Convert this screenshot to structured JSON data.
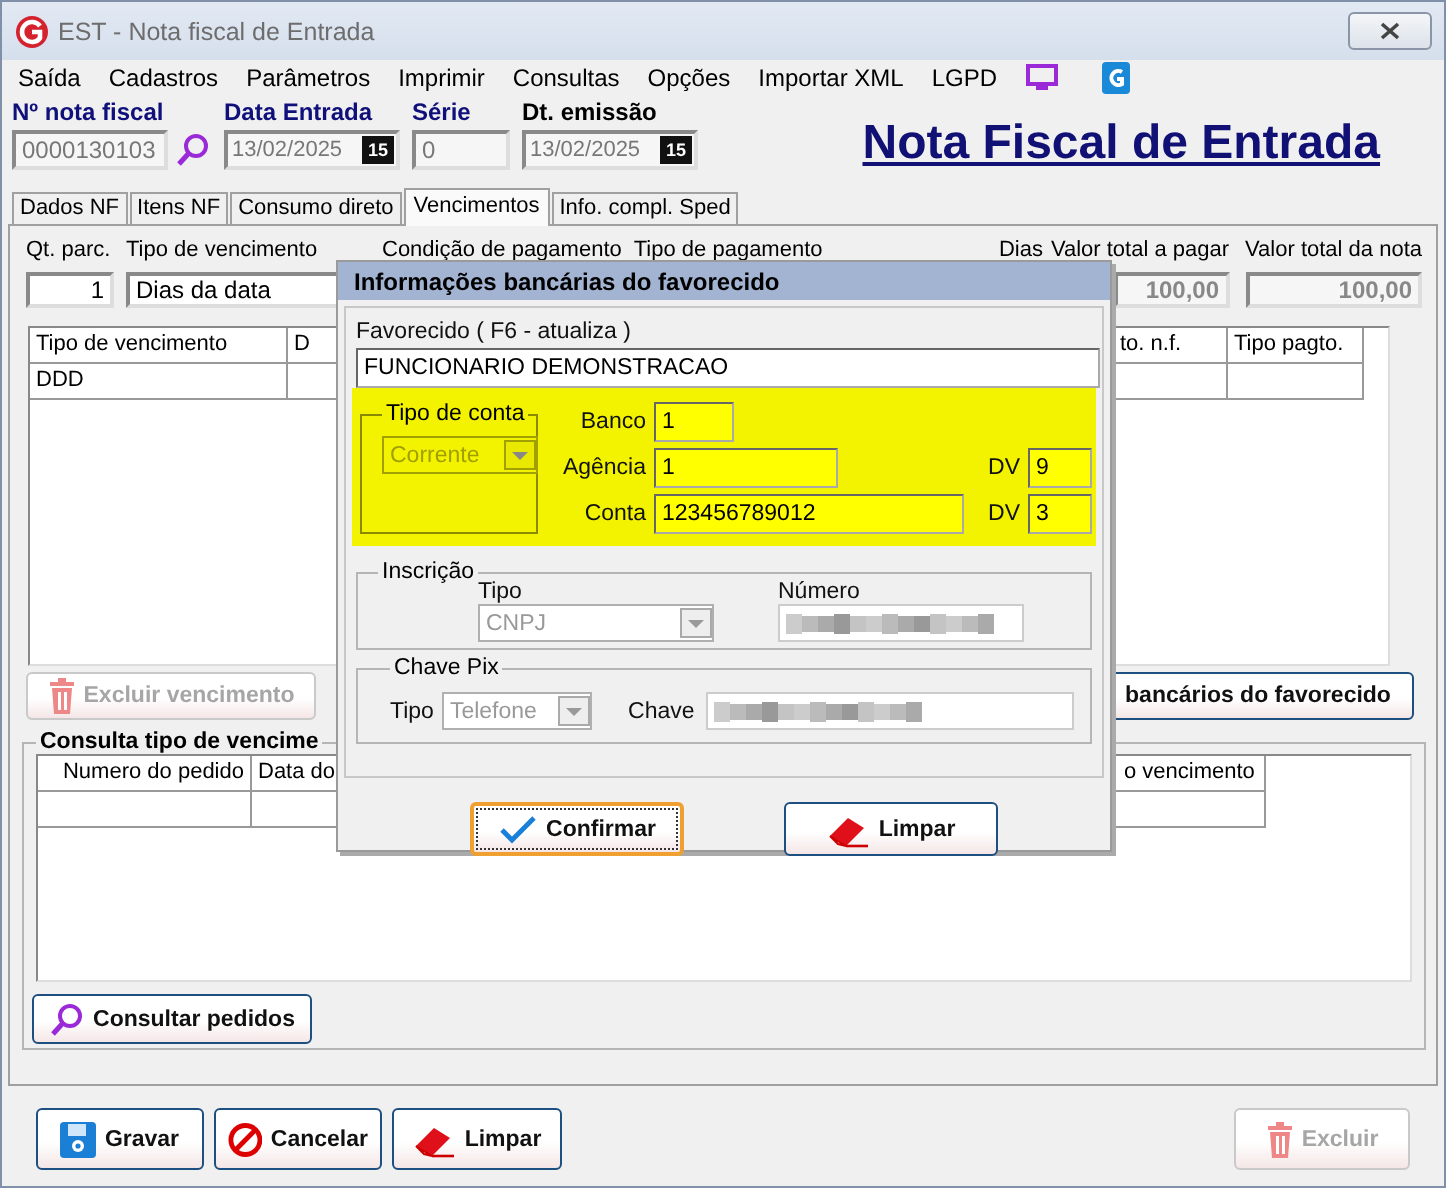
{
  "window": {
    "title": "EST - Nota fiscal de Entrada"
  },
  "menu": [
    "Saída",
    "Cadastros",
    "Parâmetros",
    "Imprimir",
    "Consultas",
    "Opções",
    "Importar XML",
    "LGPD"
  ],
  "header": {
    "fields": [
      {
        "label": "Nº nota fiscal",
        "value": "0000130103",
        "kind": "search"
      },
      {
        "label": "Data Entrada",
        "value": "13/02/2025",
        "kind": "date",
        "calendar_day": "15"
      },
      {
        "label": "Série",
        "value": "0",
        "kind": "plain"
      },
      {
        "label": "Dt. emissão",
        "value": "13/02/2025",
        "kind": "date",
        "calendar_day": "15"
      }
    ],
    "heading": "Nota Fiscal de Entrada"
  },
  "tabs": [
    {
      "label": "Dados NF",
      "selected": false
    },
    {
      "label": "Itens NF",
      "selected": false
    },
    {
      "label": "Consumo direto",
      "selected": false
    },
    {
      "label": "Vencimentos",
      "selected": true
    },
    {
      "label": "Info. compl. Sped",
      "selected": false
    }
  ],
  "installments": {
    "qt": {
      "label": "Qt. parc.",
      "value": "1"
    },
    "due_type": {
      "label": "Tipo de vencimento",
      "value": "Dias da data"
    },
    "covered_labels": [
      "Condição de pagamento",
      "Tipo de pagamento",
      "Dias"
    ],
    "totals": [
      {
        "label": "Valor total a pagar",
        "value": "100,00"
      },
      {
        "label": "Valor total da nota",
        "value": "100,00"
      }
    ]
  },
  "due_grid": {
    "columns_left": [
      "Tipo de vencimento",
      "D"
    ],
    "columns_right": [
      "to. n.f.",
      "Tipo pagto."
    ],
    "rows": [
      [
        "DDD"
      ]
    ]
  },
  "actions": [
    {
      "label": "Excluir vencimento",
      "kind": "delete",
      "disabled": true
    },
    {
      "label": "bancários do favorecido",
      "kind": "plain",
      "disabled": false
    }
  ],
  "orders": {
    "title": "Consulta tipo de vencime",
    "columns_left": [
      "Numero do pedido",
      "Data do"
    ],
    "columns_right": [
      "o vencimento"
    ],
    "button": "Consultar pedidos"
  },
  "dialog": {
    "title": "Informações bancárias do favorecido",
    "favorecido": {
      "label": "Favorecido ( F6 - atualiza )",
      "value": "FUNCIONARIO DEMONSTRACAO"
    },
    "account_type": {
      "label": "Tipo de conta",
      "value": "Corrente",
      "disabled": true
    },
    "bank": [
      {
        "label": "Banco",
        "value": "1"
      },
      {
        "label": "Agência",
        "value": "1",
        "dv_label": "DV",
        "dv": "9"
      },
      {
        "label": "Conta",
        "value": "123456789012",
        "dv_label": "DV",
        "dv": "3"
      }
    ],
    "inscricao": {
      "title": "Inscrição",
      "type_label": "Tipo",
      "type_value": "CNPJ",
      "number_label": "Número"
    },
    "pix": {
      "title": "Chave Pix",
      "type_label": "Tipo",
      "type_value": "Telefone",
      "key_label": "Chave"
    },
    "buttons": [
      {
        "label": "Confirmar",
        "kind": "confirm",
        "focused": true
      },
      {
        "label": "Limpar",
        "kind": "clear",
        "focused": false
      }
    ]
  },
  "footer": {
    "buttons": [
      {
        "label": "Gravar",
        "kind": "save",
        "disabled": false
      },
      {
        "label": "Cancelar",
        "kind": "cancel",
        "disabled": false
      },
      {
        "label": "Limpar",
        "kind": "clear",
        "disabled": false
      },
      {
        "label": "Excluir",
        "kind": "delete",
        "disabled": true
      }
    ]
  }
}
